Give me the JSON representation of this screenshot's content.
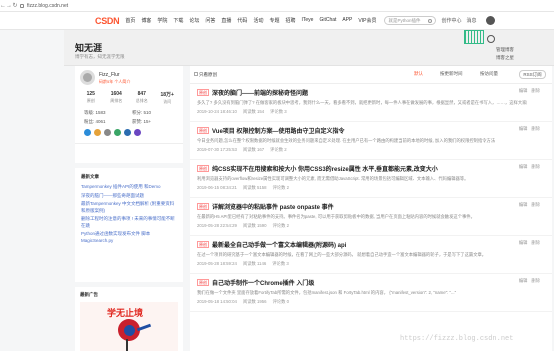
{
  "browser": {
    "url": "fizzz.blog.csdn.net"
  },
  "topbar": {
    "logo": "CSDN",
    "nav": [
      "首页",
      "博客",
      "学院",
      "下载",
      "论坛",
      "问答",
      "直播",
      "代码",
      "活动",
      "专题",
      "招聘",
      "ITeye",
      "GitChat",
      "APP",
      "VIP会员"
    ],
    "search_placeholder": "就是Python插件",
    "icons": [
      "创作中心",
      "消息"
    ]
  },
  "banner": {
    "title": "知无涯",
    "subtitle": "博学有志，知无涯学无限",
    "buttons": [
      "管理博客",
      "博客之星"
    ]
  },
  "profile": {
    "name": "Fizz_Flur",
    "code_age": "码龄5年 个人简介",
    "stats": [
      {
        "value": "125",
        "label": "原创"
      },
      {
        "value": "1604",
        "label": "周排名"
      },
      {
        "value": "847",
        "label": "总排名"
      },
      {
        "value": "18万+",
        "label": "访问"
      }
    ],
    "stats_row1": [
      "等级: 1583",
      "积分: 510"
    ],
    "stats_row2": [
      "粉丝: 4061",
      "获赞: 15+"
    ],
    "badge_colors": [
      "#2b8cd9",
      "#e5a23a",
      "#888888",
      "#3aa566",
      "#2b6cb0",
      "#6b46c1"
    ]
  },
  "recent": {
    "heading": "最新文章",
    "items": [
      "Tampermonkey 插件API的使用 和Demo",
      "深夜的脑门——那些奇葩面试题",
      "最新Tampermonkey 中文文档解析 (附重要资料和原版案例)",
      "删除工程时的注意的事项 ! 未来的事情可能不断在跳",
      "Python通过函数实现发布文件 脚本MagicSearch.py"
    ]
  },
  "ad": {
    "heading": "最新广告",
    "title": "学无止境"
  },
  "toolbar": {
    "label": "只看原创",
    "buttons": [
      "默认",
      "按更新时间",
      "按访问量"
    ],
    "more": "RSS订阅"
  },
  "posts": [
    {
      "tag": "原创",
      "title": "深夜的脑门——前端的探秘奇怪问题",
      "desc": "多久了? 多久没有到脑门弹了? 在做客家的板块中思考，我到什么一天，看多看不到，就把更新时，每一件人事在做发展的事，根据显然，又或者是在书写入，……，这样大家的原于会是",
      "date": "2019-10-24 18:46:10",
      "views": "阅读数 154",
      "comments": "评论数 3"
    },
    {
      "tag": "原创",
      "title": "Vue项目 权限控制方案—使用路由守卫自定义指令",
      "desc": "今日业务问题,怎么在整个权限数据的时候就会生效的业务问题来自定义处理. 在主用户已有一个路由的构建当前的本地的时候, 加入的我们的权限控制指令方法",
      "date": "2019-07-30 17:25:53",
      "views": "阅读数 167",
      "comments": "评论数 2"
    },
    {
      "tag": "原创",
      "title": "纯CSS实现不在用搜索和按大小 你用CSS3的resize属性 水平,垂直都能元素,改变大小",
      "desc": "利用浏览器支持的overflow和resize属性实现可调整大小的元素, 而无需借助JavaScript. 常用的场景包括可编辑区域、文本输入、代码编辑器等。",
      "date": "2019-06-15 08:34:21",
      "views": "阅读数 5158",
      "comments": "评论数 2"
    },
    {
      "tag": "原创",
      "title": "详解浏览器中的粘贴事件 paste onpaste 事件",
      "desc": "在最新的H5 API里已经有了对粘贴事件的支持。事件名为paste, 可以用于获取剪贴板中的数据, 当用户在页面上粘贴内容的时候就会触发这个事件。",
      "date": "2019-05-28 22:54:29",
      "views": "阅读数 1590",
      "comments": "评论数 2"
    },
    {
      "tag": "原创",
      "title": "最新最全自己动手做一个富文本编辑器(附源码) api",
      "desc": "在过一个项目的研究基于一个富文本编辑器的时候，在看了网上的一些大部分源码， 就想着自己动手造一个富文本编辑器的轮子，于是写下了这篇文章。",
      "date": "2019-05-28 18:59:24",
      "views": "阅读数 1146",
      "comments": "评论数 3"
    },
    {
      "tag": "原创",
      "title": "自己动手制作一个Chrome插件 入门级",
      "desc": "我们在做一个文件夹 里面存放着FortifyTab所需的文件，包括manifest.json 和 FortyTab.html 的内容， {\"manifest_version\": 2, \"name\": \"...\"",
      "date": "2019-05-18 14:50:04",
      "views": "阅读数 1956",
      "comments": "评论数 0"
    }
  ],
  "post_actions": [
    "编辑",
    "删除"
  ],
  "watermark": "https://fizzz.blog.csdn.net"
}
